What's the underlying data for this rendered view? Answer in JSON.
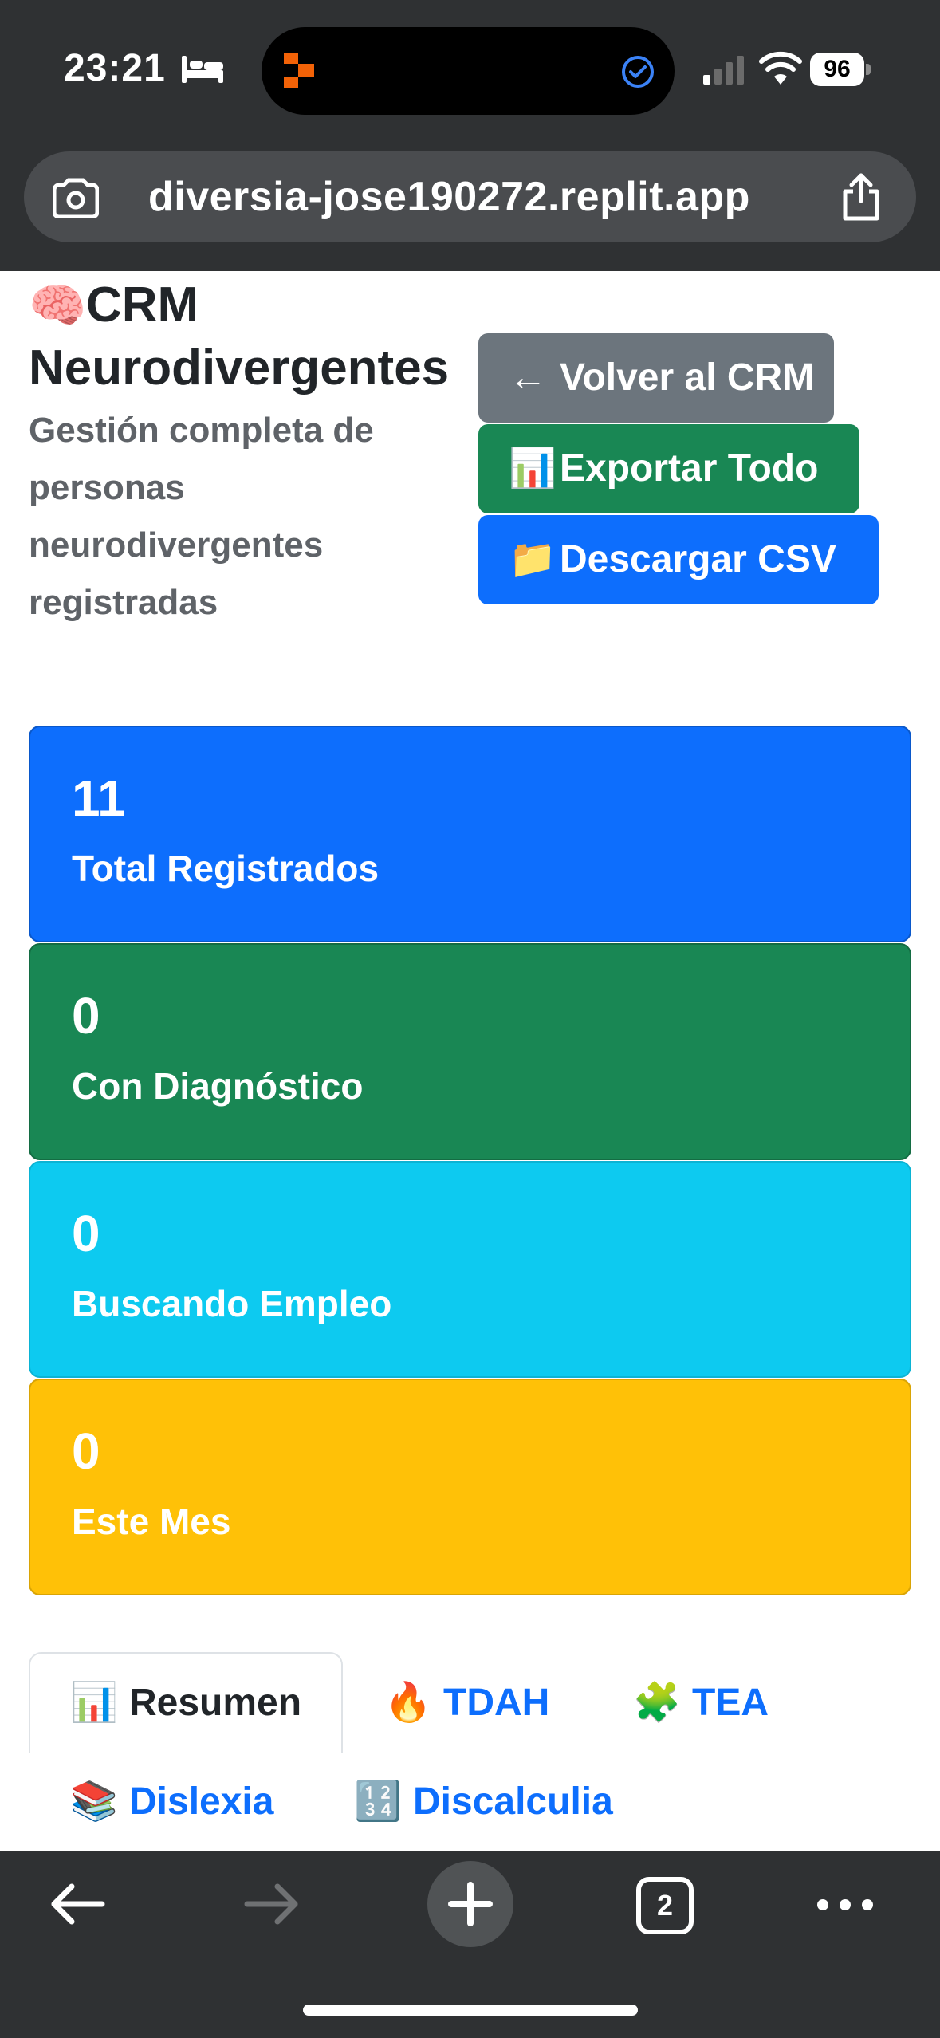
{
  "status_bar": {
    "time": "23:21",
    "battery": "96",
    "icons": [
      "bed-icon",
      "app-activity-icon",
      "check-circle-icon",
      "signal-icon",
      "wifi-icon"
    ]
  },
  "browser": {
    "url": "diversia-jose190272.replit.app",
    "open_tabs": "2",
    "icons": [
      "lens-icon",
      "share-icon",
      "back-arrow-icon",
      "forward-arrow-icon",
      "plus-icon",
      "more-icon"
    ]
  },
  "header": {
    "title_emoji": "🧠",
    "title": "CRM Neurodivergentes",
    "subtitle": "Gestión completa de personas neurodivergentes registradas"
  },
  "actions": {
    "back": {
      "icon": "←",
      "label": "Volver al CRM"
    },
    "export": {
      "icon": "📊",
      "label": "Exportar Todo"
    },
    "csv": {
      "icon": "📁",
      "label": "Descargar CSV"
    }
  },
  "stats": {
    "total": {
      "value": "11",
      "label": "Total Registrados"
    },
    "diagnosis": {
      "value": "0",
      "label": "Con Diagnóstico"
    },
    "job_seeking": {
      "value": "0",
      "label": "Buscando Empleo"
    },
    "this_month": {
      "value": "0",
      "label": "Este Mes"
    }
  },
  "tabs": [
    {
      "icon": "📊",
      "label": "Resumen",
      "active": true
    },
    {
      "icon": "🔥",
      "label": "TDAH"
    },
    {
      "icon": "🧩",
      "label": "TEA"
    },
    {
      "icon": "📚",
      "label": "Dislexia"
    },
    {
      "icon": "🔢",
      "label": "Discalculia"
    }
  ],
  "colors": {
    "primary": "#0d6efd",
    "secondary": "#6c757d",
    "success": "#198754",
    "info": "#0dcaf0",
    "warning": "#ffc107",
    "chrome": "#2f3133"
  }
}
